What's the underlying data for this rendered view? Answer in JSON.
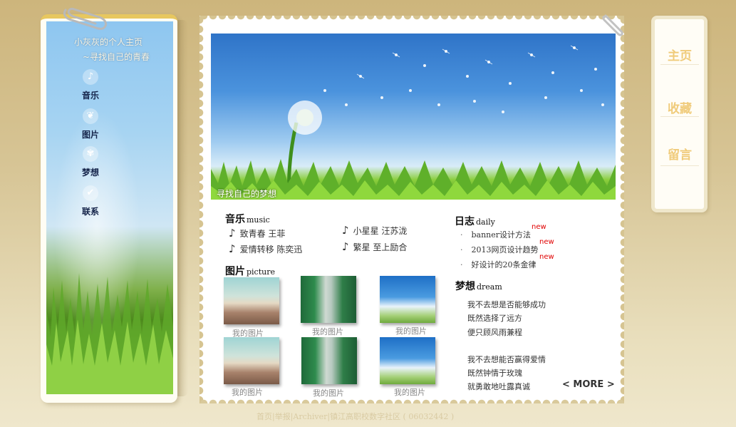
{
  "sidebar": {
    "title": "小灰灰的个人主页",
    "subtitle": "~寻找自己的青春",
    "items": [
      {
        "label": "音乐",
        "icon": "music-icon"
      },
      {
        "label": "图片",
        "icon": "leaf-icon"
      },
      {
        "label": "梦想",
        "icon": "sprout-icon"
      },
      {
        "label": "联系",
        "icon": "check-icon"
      }
    ]
  },
  "banner": {
    "caption": "寻找自己的梦想"
  },
  "music": {
    "title": "音乐",
    "title_en": "music",
    "songs": [
      {
        "title": "致青春  王菲"
      },
      {
        "title": "小星星  汪苏泷"
      },
      {
        "title": "爱情转移  陈奕迅"
      },
      {
        "title": "繁星  至上励合"
      }
    ]
  },
  "pictures": {
    "title": "图片",
    "title_en": "picture",
    "items": [
      {
        "caption": "我的图片"
      },
      {
        "caption": "我的图片"
      },
      {
        "caption": "我的图片"
      },
      {
        "caption": "我的图片"
      },
      {
        "caption": "我的图片"
      },
      {
        "caption": "我的图片"
      }
    ]
  },
  "diary": {
    "title": "日志",
    "title_en": "daily",
    "badge": "new",
    "items": [
      {
        "title": "banner设计方法"
      },
      {
        "title": "2013网页设计趋势"
      },
      {
        "title": "好设计的20条金律"
      }
    ]
  },
  "dream": {
    "title": "梦想",
    "title_en": "dream",
    "lines": [
      "我不去想是否能够成功",
      "既然选择了远方",
      "便只顾风雨兼程",
      "我不去想能否赢得爱情",
      "既然钟情于玫瑰",
      "就勇敢地吐露真诚"
    ],
    "more": "< MORE >"
  },
  "right_nav": {
    "items": [
      {
        "label": "主页"
      },
      {
        "label": "收藏"
      },
      {
        "label": "留言"
      }
    ]
  },
  "footer": {
    "text": "首页|举报|Archiver|镇江高职校数字社区 ( 06032442 )"
  },
  "colors": {
    "background": "#d7c596",
    "sidebar_border": "#e7c75f",
    "nav_text": "#f0cb7a",
    "new_badge": "#e00000"
  }
}
